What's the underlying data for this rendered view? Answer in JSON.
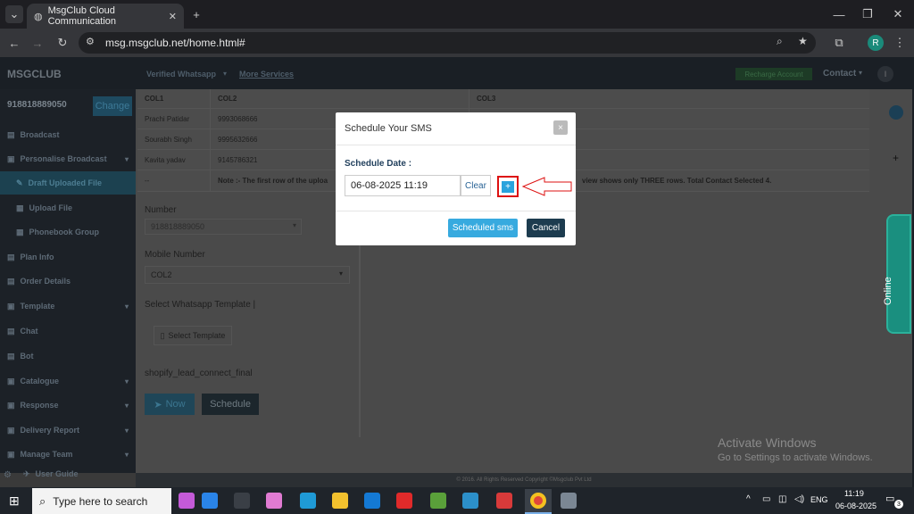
{
  "browser": {
    "tab_title": "MsgClub Cloud Communication",
    "url": "msg.msgclub.net/home.html#",
    "profile_initial": "R"
  },
  "app": {
    "logo": "MSGCLUB",
    "nav_links": [
      "Verified Whatsapp",
      "More Services"
    ],
    "recharge_label": "Recharge Account",
    "contact_label": "Contact",
    "user_initial": "I"
  },
  "sidebar": {
    "phone": "918818889050",
    "change_label": "Change",
    "items": [
      {
        "label": "Broadcast",
        "icon": "broadcast-icon"
      },
      {
        "label": "Personalise Broadcast",
        "icon": "personalise-icon"
      },
      {
        "label": "Draft Uploaded File",
        "icon": "draft-icon"
      },
      {
        "label": "Upload File",
        "icon": "upload-icon"
      },
      {
        "label": "Phonebook Group",
        "icon": "phonebook-icon"
      },
      {
        "label": "Plan Info",
        "icon": "plan-icon"
      },
      {
        "label": "Order Details",
        "icon": "order-icon"
      },
      {
        "label": "Template",
        "icon": "template-icon"
      },
      {
        "label": "Chat",
        "icon": "chat-icon"
      },
      {
        "label": "Bot",
        "icon": "bot-icon"
      },
      {
        "label": "Catalogue",
        "icon": "catalogue-icon"
      },
      {
        "label": "Response",
        "icon": "response-icon"
      },
      {
        "label": "Delivery Report",
        "icon": "report-icon"
      },
      {
        "label": "Manage Team",
        "icon": "team-icon"
      },
      {
        "label": "User Guide",
        "icon": "guide-icon"
      }
    ]
  },
  "table": {
    "headers": [
      "COL1",
      "COL2",
      "COL3"
    ],
    "rows": [
      [
        "Prachi Patidar",
        "9993068666"
      ],
      [
        "Sourabh Singh",
        "9995632666"
      ],
      [
        "Kavita yadav",
        "9145786321"
      ]
    ],
    "note_dash": "--",
    "note_left": "Note :- The first row of the uploa",
    "note_right": "view shows only THREE rows. Total Contact Selected 4."
  },
  "form": {
    "number_label": "Number",
    "number_value": "918818889050",
    "mobile_label": "Mobile Number",
    "mobile_value": "COL2",
    "template_label": "Select Whatsapp Template |",
    "select_template_label": "Select Template",
    "template_name": "shopify_lead_connect_final",
    "now_label": "Now",
    "schedule_label": "Schedule"
  },
  "modal": {
    "title": "Schedule Your SMS",
    "close": "×",
    "date_label": "Schedule Date :",
    "date_value": "06-08-2025 11:19",
    "clear_label": "Clear",
    "plus_label": "+",
    "scheduled_label": "Scheduled sms",
    "cancel_label": "Cancel"
  },
  "online_label": "Online",
  "footer": "© 2016. All Rights Reserved Copyright ©Msgclub Pvt Ltd",
  "watermark": {
    "title": "Activate Windows",
    "subtitle": "Go to Settings to activate Windows."
  },
  "taskbar": {
    "search_placeholder": "Type here to search",
    "lang": "ENG",
    "time": "11:19",
    "date": "06-08-2025",
    "notif_count": "3"
  }
}
